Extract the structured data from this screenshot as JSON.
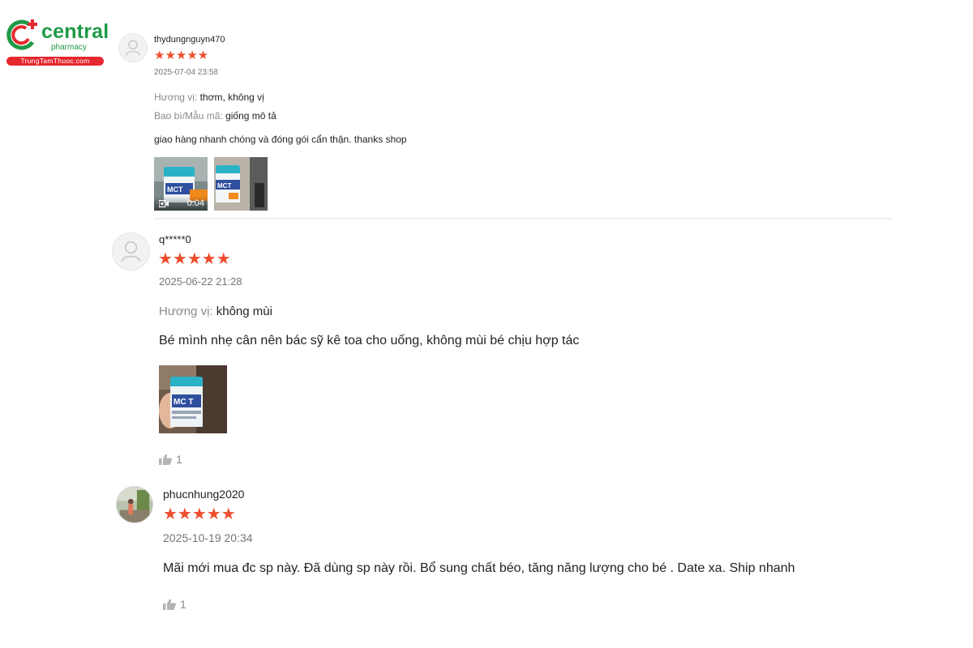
{
  "logo": {
    "brand": "central",
    "sub": "pharmacy",
    "site": "TrungTamThuoc.com"
  },
  "colors": {
    "star": "#ee4d2d",
    "brand_green": "#1f9a48",
    "brand_red": "#e5282e"
  },
  "reviews": [
    {
      "username": "thydungnguyn470",
      "stars": "★★★★★",
      "rating": 5,
      "date": "2025-07-04 23:58",
      "attributes": [
        {
          "key": "Hương vị:",
          "value": "thơm, không vị"
        },
        {
          "key": "Bao bì/Mẫu mã:",
          "value": "giống mô tả"
        }
      ],
      "content": "giao hàng nhanh chóng và đóng gói cẩn thận. thanks shop",
      "media": [
        {
          "type": "video",
          "duration": "0:04",
          "label": "MCT"
        },
        {
          "type": "image",
          "label": "MCT"
        }
      ]
    },
    {
      "username": "q*****0",
      "stars": "★★★★★",
      "rating": 5,
      "date": "2025-06-22 21:28",
      "attributes": [
        {
          "key": "Hương vị:",
          "value": "không mùi"
        }
      ],
      "content": "Bé mình nhẹ cân nên bác sỹ kê toa cho uống, không mùi bé chịu hợp tác",
      "media": [
        {
          "type": "image",
          "label": "MC T"
        }
      ],
      "likes": "1"
    },
    {
      "username": "phucnhung2020",
      "stars": "★★★★★",
      "rating": 5,
      "date": "2025-10-19 20:34",
      "content": "Mãi mới mua đc sp này. Đã dùng sp này rồi. Bổ sung chất béo, tăng năng lượng cho bé . Date xa. Ship nhanh",
      "likes": "1"
    }
  ]
}
